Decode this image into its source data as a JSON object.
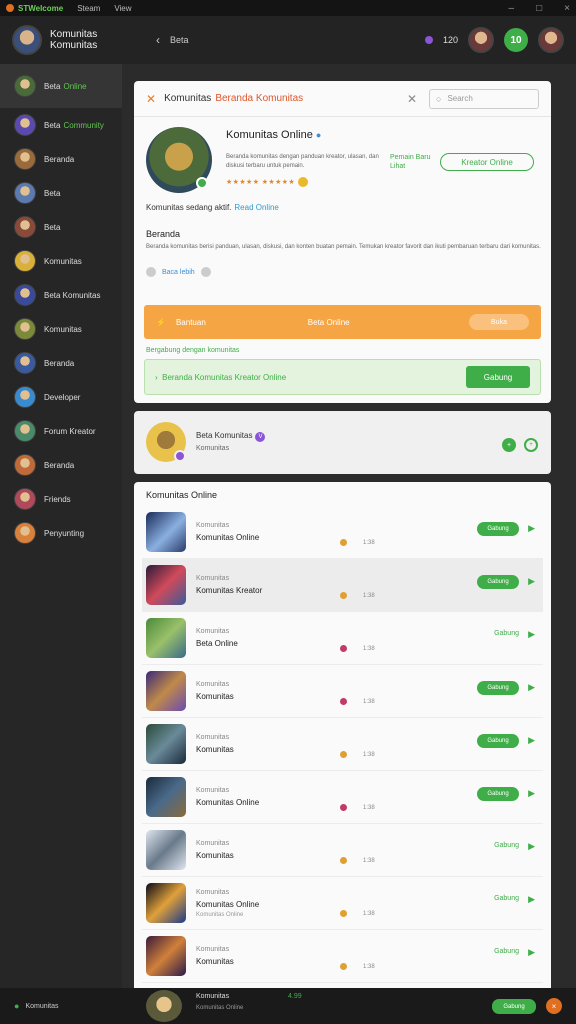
{
  "topbar": {
    "app": "STWelcome",
    "menu": "Steam",
    "menu2": "View"
  },
  "header": {
    "title_line1": "Komunitas",
    "title_line2": "Komunitas",
    "back": "‹",
    "crumb": "Beta",
    "count": "120",
    "badge": "10"
  },
  "sidebar": {
    "items": [
      {
        "label": "Beta",
        "extra": "Online",
        "color": "#4a6a3a"
      },
      {
        "label": "Beta",
        "extra": "Community",
        "color": "#5a4ab0"
      },
      {
        "label": "Beranda",
        "extra": "",
        "color": "#9a6a3a"
      },
      {
        "label": "Beta",
        "extra": "",
        "color": "#5a7ab0"
      },
      {
        "label": "Beta",
        "extra": "",
        "color": "#8a4a3a"
      },
      {
        "label": "Komunitas",
        "extra": "",
        "color": "#d9b03a"
      },
      {
        "label": "Beta Komunitas",
        "extra": "",
        "color": "#3a4a9a"
      },
      {
        "label": "Komunitas",
        "extra": "",
        "color": "#7a8a3a"
      },
      {
        "label": "Beranda",
        "extra": "",
        "color": "#3a5aa0"
      },
      {
        "label": "Developer",
        "extra": "",
        "color": "#3a8ad0"
      },
      {
        "label": "Forum Kreator",
        "extra": "",
        "color": "#4a8a6a"
      },
      {
        "label": "Beranda",
        "extra": "",
        "color": "#c06a3a"
      },
      {
        "label": "Friends",
        "extra": "",
        "color": "#b04a5a"
      },
      {
        "label": "Penyunting",
        "extra": "",
        "color": "#d9803a"
      }
    ]
  },
  "card1": {
    "title": "Komunitas",
    "subtitle": "Beranda Komunitas",
    "search_placeholder": "Search",
    "profile_name": "Komunitas Online",
    "profile_desc": "Beranda komunitas dengan panduan kreator, ulasan, dan diskusi terbaru untuk pemain.",
    "profile_tag": "Pemain Baru Lihat",
    "profile_button": "Kreator Online",
    "rating": "★★★★★ ★★★★★",
    "online_text": "Komunitas sedang aktif.",
    "online_link": "Read Online",
    "section_title": "Beranda",
    "section_text": "Beranda komunitas berisi panduan, ulasan, diskusi, dan konten buatan pemain. Temukan kreator favorit dan ikuti pembaruan terbaru dari komunitas.",
    "chip": "Baca lebih",
    "orange_label": "Bantuan",
    "orange_mid": "Beta Online",
    "orange_btn": "Buka",
    "green_caption": "Bergabung dengan komunitas",
    "green_text": "Beranda Komunitas Kreator Online",
    "green_btn": "Gabung"
  },
  "card2": {
    "line1": "Beta Komunitas",
    "line2": "Komunitas",
    "icon1": "+",
    "icon2": "+"
  },
  "card3": {
    "title": "Komunitas Online",
    "games": [
      {
        "cat": "Komunitas",
        "name": "Komunitas Online",
        "sub": "",
        "dot": "#e0a030",
        "meta": "1:38",
        "btn": "Gabung",
        "txt": "",
        "thumb": "linear-gradient(135deg,#1a2a5a,#8ab0e0 55%,#2a3a6a)"
      },
      {
        "cat": "Komunitas",
        "name": "Komunitas Kreator",
        "sub": "",
        "dot": "#e0a030",
        "meta": "1:38",
        "btn": "Gabung",
        "txt": "",
        "thumb": "linear-gradient(135deg,#2a1a3a,#d04a5a 50%,#3a5a9a)"
      },
      {
        "cat": "Komunitas",
        "name": "Beta Online",
        "sub": "",
        "dot": "#c03a6a",
        "meta": "1:38",
        "btn": "",
        "txt": "Gabung",
        "thumb": "linear-gradient(135deg,#4a8a3a,#9ac06a 50%,#3a6a8a)"
      },
      {
        "cat": "Komunitas",
        "name": "Komunitas",
        "sub": "",
        "dot": "#c03a6a",
        "meta": "1:38",
        "btn": "Gabung",
        "txt": "",
        "thumb": "linear-gradient(135deg,#3a2a7a,#c08a4a 50%,#6a4ab0)"
      },
      {
        "cat": "Komunitas",
        "name": "Komunitas",
        "sub": "",
        "dot": "#e0a030",
        "meta": "1:38",
        "btn": "Gabung",
        "txt": "",
        "thumb": "linear-gradient(135deg,#2a4a3a,#6a8a9a 50%,#1a2a3a)"
      },
      {
        "cat": "Komunitas",
        "name": "Komunitas Online",
        "sub": "",
        "dot": "#c03a6a",
        "meta": "1:38",
        "btn": "Gabung",
        "txt": "",
        "thumb": "linear-gradient(135deg,#1a2a3a,#4a6a8a 50%,#8a6a3a)"
      },
      {
        "cat": "Komunitas",
        "name": "Komunitas",
        "sub": "",
        "dot": "#e0a030",
        "meta": "1:38",
        "btn": "",
        "txt": "Gabung",
        "thumb": "linear-gradient(135deg,#dfe6f0,#6a7a8a 50%,#dfe6f0)"
      },
      {
        "cat": "Komunitas",
        "name": "Komunitas Online",
        "sub": "Komunitas Online",
        "dot": "#e0a030",
        "meta": "1:38",
        "btn": "",
        "txt": "Gabung",
        "thumb": "linear-gradient(135deg,#0a0a1a,#e0a03a 50%,#1a3a8a)"
      },
      {
        "cat": "Komunitas",
        "name": "Komunitas",
        "sub": "",
        "dot": "#e0a030",
        "meta": "1:38",
        "btn": "",
        "txt": "Gabung",
        "thumb": "linear-gradient(135deg,#3a1a3a,#d0803a 50%,#2a1a4a)"
      }
    ]
  },
  "bottombar": {
    "label": "Komunitas",
    "line1": "Komunitas",
    "line2": "Komunitas Online",
    "num": "4.99",
    "btn": "Gabung",
    "close": "×"
  }
}
